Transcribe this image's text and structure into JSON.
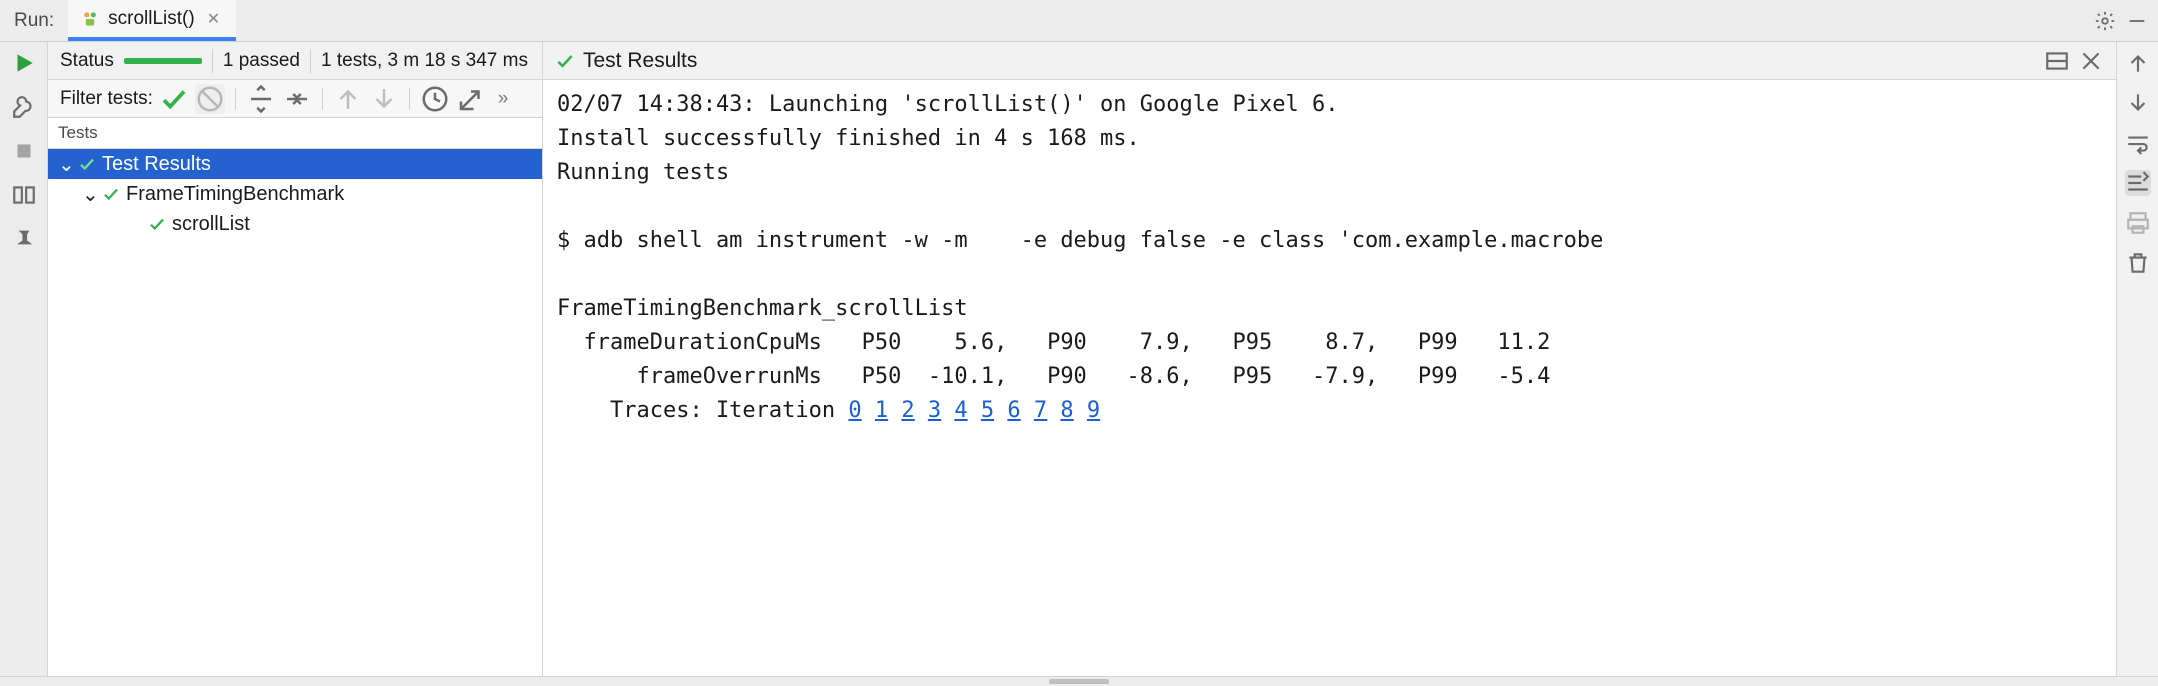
{
  "header": {
    "run_label": "Run:",
    "tab_name": "scrollList()"
  },
  "status": {
    "label": "Status",
    "passed": "1 passed",
    "summary": "1 tests, 3 m 18 s 347 ms"
  },
  "filter": {
    "label": "Filter tests:"
  },
  "tests_panel": {
    "header": "Tests",
    "tree": [
      {
        "depth": 0,
        "label": "Test Results",
        "selected": true,
        "expanded": true,
        "has_chev": true
      },
      {
        "depth": 1,
        "label": "FrameTimingBenchmark",
        "selected": false,
        "expanded": true,
        "has_chev": true
      },
      {
        "depth": 2,
        "label": "scrollList",
        "selected": false,
        "has_chev": false
      }
    ]
  },
  "output": {
    "title": "Test Results",
    "lines": [
      "02/07 14:38:43: Launching 'scrollList()' on Google Pixel 6.",
      "Install successfully finished in 4 s 168 ms.",
      "Running tests",
      "",
      "$ adb shell am instrument -w -m    -e debug false -e class 'com.example.macrobe",
      "",
      "FrameTimingBenchmark_scrollList",
      "  frameDurationCpuMs   P50    5.6,   P90    7.9,   P95    8.7,   P99   11.2",
      "      frameOverrunMs   P50  -10.1,   P90   -8.6,   P95   -7.9,   P99   -5.4"
    ],
    "traces_prefix": "    Traces: Iteration ",
    "trace_links": [
      "0",
      "1",
      "2",
      "3",
      "4",
      "5",
      "6",
      "7",
      "8",
      "9"
    ]
  },
  "colors": {
    "accent_blue": "#2462d0",
    "pass_green": "#33b24a",
    "link_blue": "#1a5fd6"
  }
}
